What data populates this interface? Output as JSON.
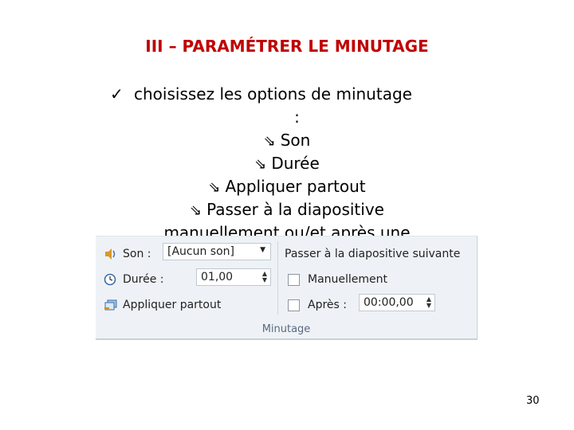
{
  "title": "III – PARAMÉTRER LE MINUTAGE",
  "bullets": {
    "check_icon": "check-mark",
    "first": "choisissez les options de minutage",
    "colon": ":",
    "arrow_icon": "outlined-arrow",
    "items": [
      "Son",
      "Durée",
      "Appliquer partout",
      "Passer à la diapositive",
      "manuellement ou/et après une"
    ]
  },
  "ribbon": {
    "sound_label": "Son :",
    "sound_value": "[Aucun son]",
    "duration_label": "Durée :",
    "duration_value": "01,00",
    "apply_all_label": "Appliquer partout",
    "advance_title": "Passer à la diapositive suivante",
    "manual_label": "Manuellement",
    "after_label": "Après :",
    "after_value": "00:00,00",
    "group_label": "Minutage"
  },
  "page_number": "30"
}
